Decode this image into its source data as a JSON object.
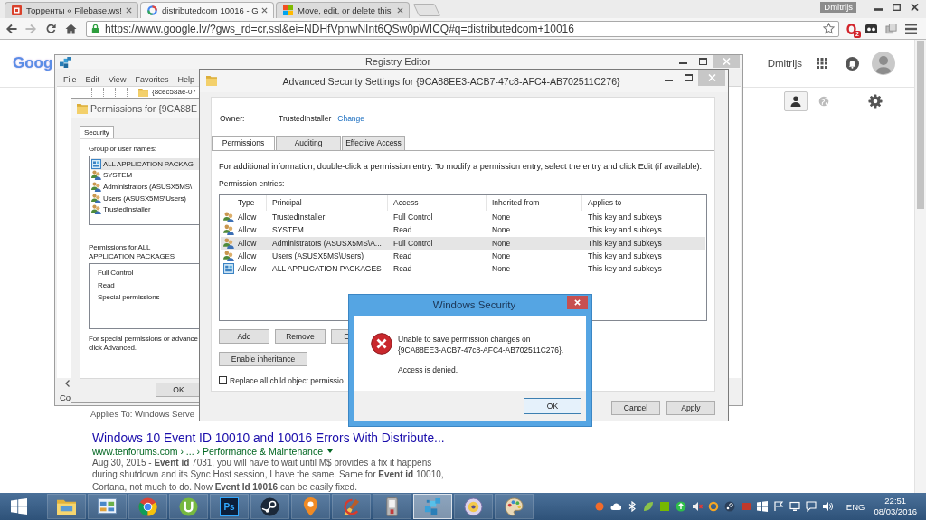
{
  "browser": {
    "tabs": [
      {
        "title": "Торренты « Filebase.ws!",
        "selected": false
      },
      {
        "title": "distributedcom 10016 - G",
        "selected": true
      },
      {
        "title": "Move, edit, or delete this",
        "selected": false
      }
    ],
    "profile_badge": "Dmitrijs",
    "address": "https://www.google.lv/?gws_rd=cr,ssl&ei=NDHfVpnwNInt6QSw0pWICQ#q=distributedcom+10016",
    "extension_badge": "2"
  },
  "google": {
    "logo": "Goog",
    "account_name": "Dmitrijs",
    "partial_line": "Applies To: Windows Serve",
    "result": {
      "title": "Windows 10 Event ID 10010 and 10016 Errors With Distribute...",
      "url": "www.tenforums.com › ... › Performance & Maintenance",
      "snippet": "Aug 30, 2015 - **Event id** 7031, you will have to wait until M$ provides a fix it happens\nduring shutdown and its Sync Host session, I have the same. Same for **Event id** 10010,\nCortana, not much to do. Now **Event Id 10016** can be easily fixed."
    }
  },
  "registry_editor": {
    "title": "Registry Editor",
    "menu": [
      "File",
      "Edit",
      "View",
      "Favorites",
      "Help"
    ],
    "tree_item": "{8cec58ae-07",
    "status": "Co"
  },
  "permissions_dialog": {
    "title": "Permissions for {9CA88E",
    "tabs": [
      {
        "label": "Security",
        "selected": true
      }
    ],
    "group_label": "Group or user names:",
    "groups": [
      {
        "name": "ALL APPLICATION PACKAG",
        "kind": "package",
        "selected": true
      },
      {
        "name": "SYSTEM",
        "kind": "group",
        "selected": false
      },
      {
        "name": "Administrators (ASUSX5MS\\",
        "kind": "group",
        "selected": false
      },
      {
        "name": "Users (ASUSX5MS\\Users)",
        "kind": "group",
        "selected": false
      },
      {
        "name": "TrustedInstaller",
        "kind": "group",
        "selected": false
      }
    ],
    "permissions_label": "Permissions for ALL\nAPPLICATION PACKAGES",
    "permissions": [
      "Full Control",
      "Read",
      "Special permissions"
    ],
    "note": "For special permissions or advance\nclick Advanced.",
    "ok": "OK"
  },
  "advanced_security": {
    "title": "Advanced Security Settings for {9CA88EE3-ACB7-47c8-AFC4-AB702511C276}",
    "owner_label": "Owner:",
    "owner": "TrustedInstaller",
    "change_link": "Change",
    "tabs": [
      {
        "label": "Permissions",
        "selected": true
      },
      {
        "label": "Auditing",
        "selected": false
      },
      {
        "label": "Effective Access",
        "selected": false
      }
    ],
    "info": "For additional information, double-click a permission entry. To modify a permission entry, select the entry and click Edit (if available).",
    "entries_label": "Permission entries:",
    "columns": [
      "Type",
      "Principal",
      "Access",
      "Inherited from",
      "Applies to"
    ],
    "rows": [
      {
        "kind": "group",
        "type": "Allow",
        "principal": "TrustedInstaller",
        "access": "Full Control",
        "inherited_from": "None",
        "applies_to": "This key and subkeys",
        "selected": false
      },
      {
        "kind": "group",
        "type": "Allow",
        "principal": "SYSTEM",
        "access": "Read",
        "inherited_from": "None",
        "applies_to": "This key and subkeys",
        "selected": false
      },
      {
        "kind": "group",
        "type": "Allow",
        "principal": "Administrators (ASUSX5MS\\A...",
        "access": "Full Control",
        "inherited_from": "None",
        "applies_to": "This key and subkeys",
        "selected": true
      },
      {
        "kind": "group",
        "type": "Allow",
        "principal": "Users (ASUSX5MS\\Users)",
        "access": "Read",
        "inherited_from": "None",
        "applies_to": "This key and subkeys",
        "selected": false
      },
      {
        "kind": "package",
        "type": "Allow",
        "principal": "ALL APPLICATION PACKAGES",
        "access": "Read",
        "inherited_from": "None",
        "applies_to": "This key and subkeys",
        "selected": false
      }
    ],
    "buttons": [
      "Add",
      "Remove",
      "E"
    ],
    "enable_inheritance": "Enable inheritance",
    "replace_checkbox": {
      "label": "Replace all child object permissio",
      "checked": false
    },
    "footer_buttons": [
      "Cancel",
      "Apply"
    ]
  },
  "security_alert": {
    "title": "Windows Security",
    "message": "Unable to save permission changes on\n{9CA88EE3-ACB7-47c8-AFC4-AB702511C276}.",
    "detail": "Access is denied.",
    "ok": "OK"
  },
  "taskbar": {
    "apps": [
      {
        "kind": "folder",
        "selected": false
      },
      {
        "kind": "panel",
        "selected": false
      },
      {
        "kind": "browser",
        "selected": false
      },
      {
        "kind": "torrent",
        "selected": false
      },
      {
        "kind": "tile",
        "label": "Ps",
        "selected": false
      },
      {
        "kind": "steam",
        "selected": false
      },
      {
        "kind": "pin",
        "selected": false
      },
      {
        "kind": "brush",
        "selected": false
      },
      {
        "kind": "device",
        "selected": false
      },
      {
        "kind": "cubes",
        "selected": true
      },
      {
        "kind": "disc",
        "selected": false
      },
      {
        "kind": "palette",
        "selected": false
      }
    ],
    "language": "ENG",
    "time": "22:51",
    "date": "08/03/2016"
  }
}
